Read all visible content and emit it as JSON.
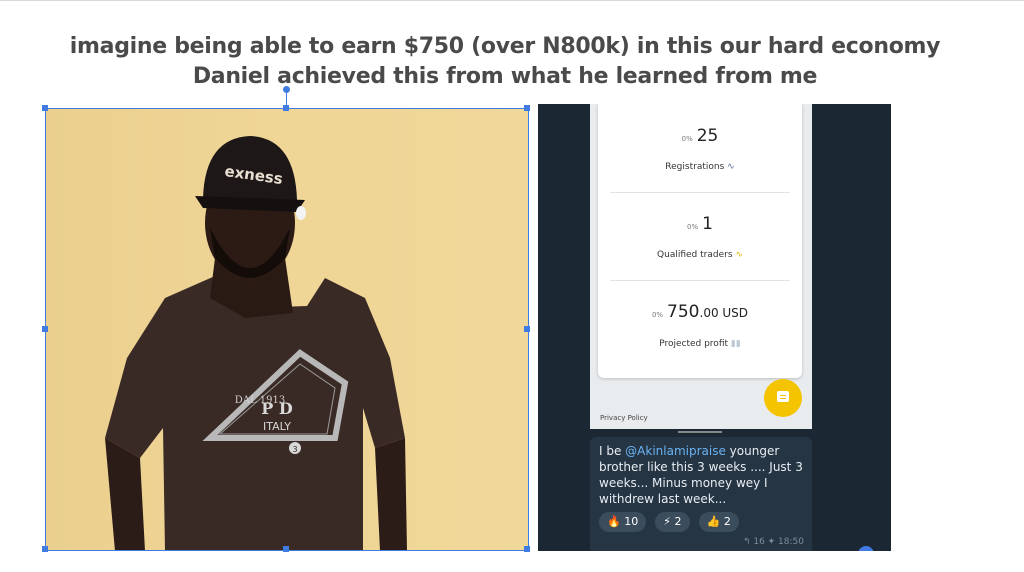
{
  "headline": {
    "line1": "imagine being able to earn $750 (over N800k) in this our hard economy",
    "line2": "Daniel achieved this from what he learned from me"
  },
  "photo": {
    "cap_text": "exness",
    "shirt_text_top": "DAL 1913",
    "shirt_text_bottom": "ITALY",
    "shirt_letters": "P   D",
    "shirt_number": "3",
    "selection_color": "#3f7be0"
  },
  "dashboard": {
    "stats": [
      {
        "pct": "0%",
        "value": "25",
        "unit": "",
        "label": "Registrations"
      },
      {
        "pct": "0%",
        "value": "1",
        "unit": "",
        "label": "Qualified traders"
      },
      {
        "pct": "0%",
        "value": "750",
        "unit": ".00 USD",
        "label": "Projected profit"
      }
    ],
    "privacy": "Privacy Policy",
    "fab_icon": "chat-icon",
    "accent": "#f5c400"
  },
  "message": {
    "prefix": "I be ",
    "mention": "@Akinlamipraise",
    "body": " younger brother like this 3 weeks .... Just 3 weeks... Minus money wey I withdrew last week...",
    "reactions": [
      {
        "emoji": "🔥",
        "count": "10"
      },
      {
        "emoji": "⚡",
        "count": "2"
      },
      {
        "emoji": "👍",
        "count": "2"
      }
    ],
    "meta": "↰ 16  ✦ 18:50"
  }
}
